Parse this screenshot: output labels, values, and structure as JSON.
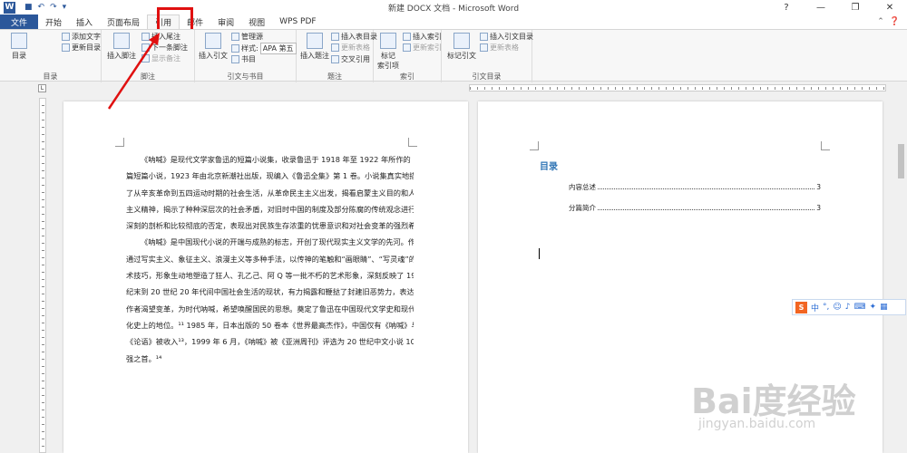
{
  "window": {
    "title": "新建 DOCX 文档 - Microsoft Word",
    "app_icon": "W",
    "qat_icons": [
      "save-icon",
      "undo-icon",
      "redo-icon",
      "customize-icon"
    ],
    "controls": [
      "?",
      "—",
      "❐",
      "✕"
    ]
  },
  "tabs": [
    "文件",
    "开始",
    "插入",
    "页面布局",
    "引用",
    "邮件",
    "审阅",
    "视图",
    "WPS PDF"
  ],
  "active_tab": "引用",
  "ribbon": {
    "toc_group": {
      "big": "目录",
      "add_text": "添加文字",
      "update": "更新目录",
      "label": "目录"
    },
    "footnote_group": {
      "insert_footnote": "插入脚注",
      "insert_endnote": "插入尾注",
      "next_footnote": "下一条脚注",
      "show_notes": "显示备注",
      "label": "脚注"
    },
    "citation_group": {
      "insert_citation": "插入引文",
      "manage_sources": "管理源",
      "style_label": "样式:",
      "style_value": "APA 第五",
      "bibliography": "书目",
      "label": "引文与书目"
    },
    "caption_group": {
      "insert_caption": "插入题注",
      "insert_table_of_figures": "插入表目录",
      "update_table": "更新表格",
      "cross_reference": "交叉引用",
      "label": "题注"
    },
    "index_group": {
      "mark_entry": "标记\n索引项",
      "insert_index": "插入索引",
      "update_index": "更新索引",
      "label": "索引"
    },
    "toa_group": {
      "mark_citation": "标记引文",
      "insert_toa": "插入引文目录",
      "update_table": "更新表格",
      "label": "引文目录"
    }
  },
  "document": {
    "page1_lines": [
      "《呐喊》是现代文学家鲁迅的短篇小说集，收录鲁迅于 1918 年至 1922 年所作的 14",
      "篇短篇小说，1923 年由北京新潮社出版，现编入《鲁迅全集》第 1 卷。小说集真实地描绘",
      "了从辛亥革命到五四运动时期的社会生活，从革命民主主义出发，揭看启蒙主义目的和人道",
      "主义精神，揭示了种种深层次的社会矛盾，对旧时中国的制度及部分陈腐的传统观念进行了",
      "深刻的剖析和比较彻底的否定，表现出对民族生存浓重的忧患意识和对社会变革的强烈希望。",
      "《呐喊》是中国现代小说的开端与成熟的标志，开创了现代现实主义文学的先河。作品",
      "通过写实主义、象征主义、浪漫主义等多种手法，以传神的笔触和“画眼睛”、“写灵魂”的艺",
      "术技巧，形象生动地塑造了狂人、孔乙己、阿 Q 等一批不朽的艺术形象，深刻反映了 19 世",
      "纪末到 20 世纪 20 年代间中国社会生活的现状，有力揭露和鞭挞了封建旧恶势力，表达了",
      "作者渴望变革，为时代呐喊，希望唤醒国民的思想。奠定了鲁迅在中国现代文学史和现代文",
      "化史上的地位。¹¹ 1985 年，日本出版的 50 卷本《世界最高杰作》，中国仅有《呐喊》与",
      "《论语》被收入¹³，1999 年 6 月，《呐喊》被《亚洲周刊》评选为 20 世纪中文小说 100",
      "强之首。¹⁴"
    ],
    "toc": {
      "title": "目录",
      "entries": [
        {
          "text": "内容总述",
          "page": "3"
        },
        {
          "text": "分篇简介",
          "page": "3"
        }
      ]
    }
  },
  "ime_toolbar": {
    "logo": "S",
    "mode": "中"
  },
  "watermark": {
    "main": "Bai度经验",
    "sub": "jingyan.baidu.com"
  },
  "colors": {
    "brand": "#2b579a",
    "highlight": "#e01010",
    "toc_heading": "#2e74b5",
    "link": "#1f4fb0"
  }
}
